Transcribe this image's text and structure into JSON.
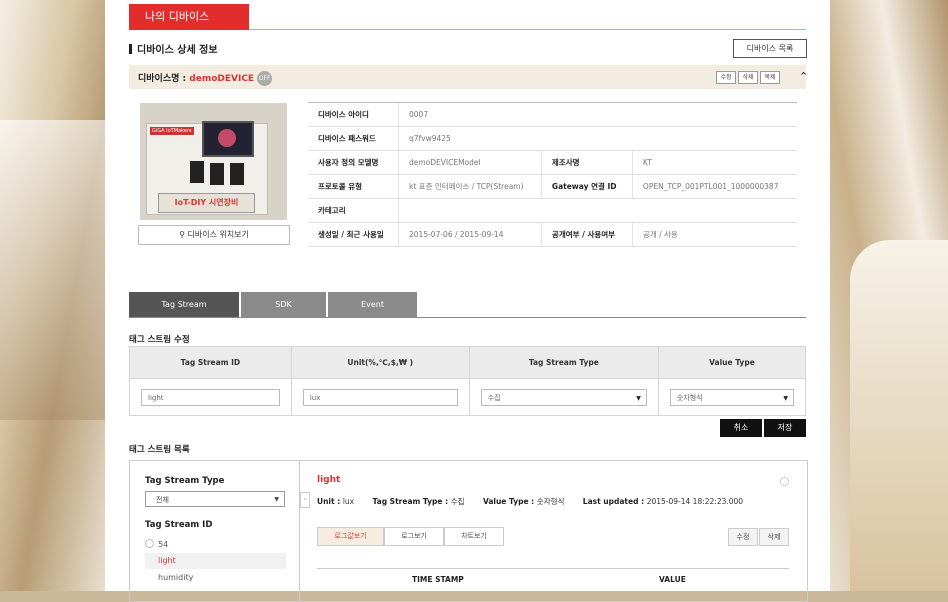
{
  "page": {
    "title": "나의 디바이스"
  },
  "detail": {
    "heading": "디바이스 상세 정보",
    "list_button": "디바이스 목록",
    "device_label": "디바이스명 : ",
    "device_name": "demoDEVICE",
    "status_badge": "OFF",
    "actions": [
      "수정",
      "삭제",
      "복제"
    ],
    "photo_plate": "IoT-DIY 시연장비",
    "photo_logo": "GiGA IoTMakers",
    "location_button": "디바이스 위치보기"
  },
  "info": {
    "device_id_label": "디바이스 아이디",
    "device_id": "0007",
    "password_label": "디바이스 패스워드",
    "password": "q7fvw9425",
    "model_label": "사용자 정의 모델명",
    "model": "demoDEVICEModel",
    "maker_label": "제조사명",
    "maker": "KT",
    "protocol_label": "프로토콜 유형",
    "protocol": "kt 표준 인터페이스 / TCP(Stream)",
    "gateway_label": "Gateway 연결 ID",
    "gateway": "OPEN_TCP_001PTL001_1000000387",
    "category_label": "카테고리",
    "category": "",
    "dates_label": "생성일 / 최근 사용일",
    "dates": "2015-07-06 / 2015-09-14",
    "public_label": "공개여부 / 사용여부",
    "public": "공개 / 사용"
  },
  "tabs": [
    "Tag Stream",
    "SDK",
    "Event"
  ],
  "edit": {
    "title": "태그 스트림 수정",
    "columns": [
      "Tag Stream ID",
      "Unit(%,℃,$,₩ )",
      "Tag Stream Type",
      "Value Type"
    ],
    "values": [
      "light",
      "lux",
      "수집",
      "숫자형식"
    ],
    "cancel": "취소",
    "save": "저장"
  },
  "list": {
    "title": "태그 스트림 목록",
    "type_label": "Tag Stream Type",
    "type_value": "전체",
    "id_label": "Tag Stream ID",
    "items": [
      "54",
      "light",
      "humidity"
    ],
    "selected": {
      "name": "light",
      "unit_label": "Unit : ",
      "unit": "lux",
      "type_label": "Tag Stream Type : ",
      "type": "수집",
      "value_type_label": "Value Type : ",
      "value_type": "숫자형식",
      "updated_label": "Last updated : ",
      "updated": "2015-09-14 18:22:23.000"
    },
    "sub_tabs": [
      "로그값보기",
      "로그보기",
      "차트보기"
    ],
    "edit_button": "수정",
    "delete_button": "삭제",
    "table_columns": [
      "TIME STAMP",
      "VALUE"
    ]
  }
}
